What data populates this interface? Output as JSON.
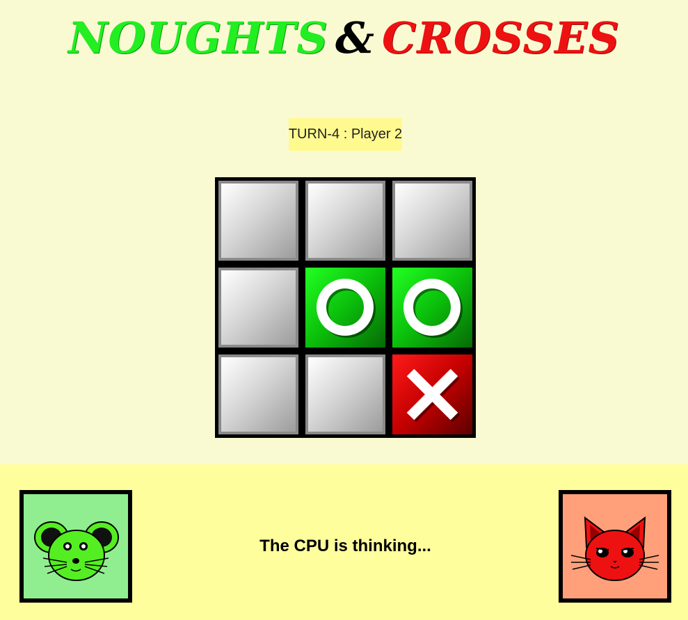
{
  "title": {
    "noughts": "NOUGHTS",
    "amp": "&",
    "crosses": "CROSSES"
  },
  "turn_label": "TURN-4 : Player 2",
  "board": [
    [
      "",
      "",
      ""
    ],
    [
      "",
      "O",
      "O"
    ],
    [
      "",
      "",
      "X"
    ]
  ],
  "status": "The CPU is thinking...",
  "players": {
    "player1": {
      "avatar": "mouse-icon",
      "color": "#90ee90"
    },
    "player2": {
      "avatar": "cat-icon",
      "color": "#ffa07a"
    }
  },
  "colors": {
    "background": "#fafad2",
    "footer": "#fffe9c",
    "turn_highlight": "#fffa8f",
    "nought": "#22ee22",
    "cross": "#ee1111"
  }
}
